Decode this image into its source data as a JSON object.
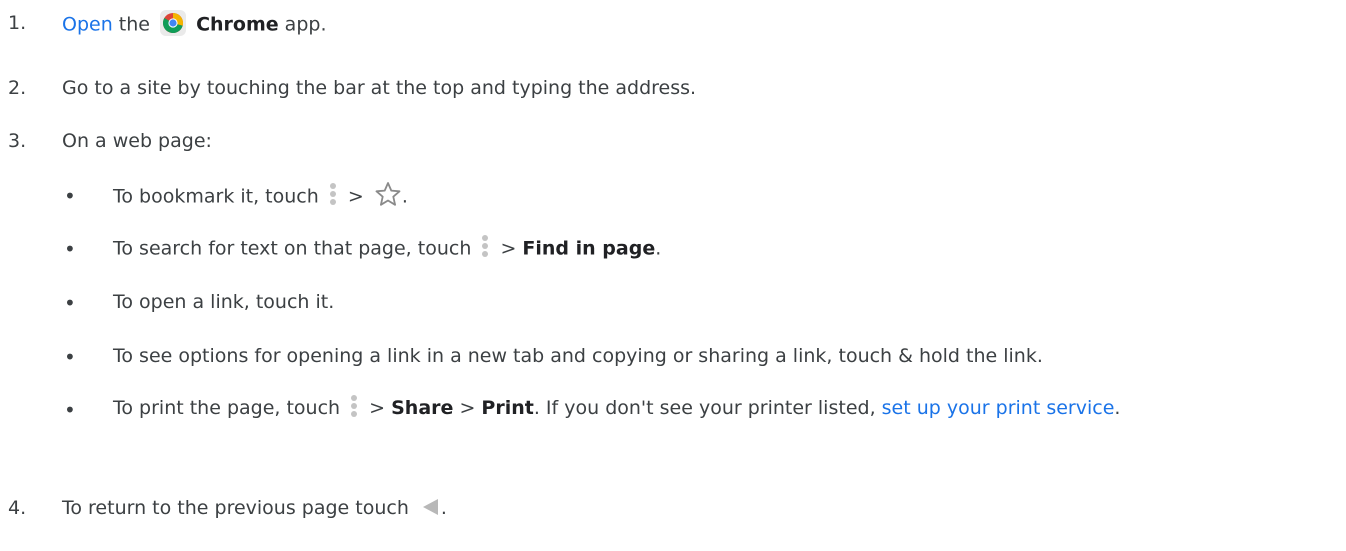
{
  "steps": [
    {
      "number": "1.",
      "link": "Open",
      "text_a": " the ",
      "app_name": "Chrome",
      "text_b": " app."
    },
    {
      "number": "2.",
      "text": "Go to a site by touching the bar at the top and typing the address."
    },
    {
      "number": "3.",
      "text": "On a web page:",
      "bullets": [
        {
          "marker": "•",
          "text_a": "To bookmark it, touch ",
          "sep": " > ",
          "end": "."
        },
        {
          "marker": "•",
          "text_a": "To search for text on that page, touch ",
          "sep": " > ",
          "bold": "Find in page",
          "end": "."
        },
        {
          "marker": "•",
          "text": "To open a link, touch it."
        },
        {
          "marker": "•",
          "text": "To see options for opening a link in a new tab and copying or sharing a link, touch & hold the link."
        },
        {
          "marker": "•",
          "text_a": "To print the page, touch ",
          "sep1": " > ",
          "bold1": "Share",
          "sep2": " > ",
          "bold2": "Print",
          "text_b": ". If you don't see your printer listed, ",
          "link": "set up your print service",
          "end": "."
        }
      ]
    },
    {
      "number": "4.",
      "text": "To return to the previous page touch",
      "end": "."
    }
  ],
  "icons": {
    "chrome": "chrome-logo-icon",
    "more": "more-vert-icon",
    "star": "star-outline-icon",
    "back": "back-triangle-icon"
  },
  "colors": {
    "link": "#1a73e8",
    "text": "#3c4043"
  }
}
